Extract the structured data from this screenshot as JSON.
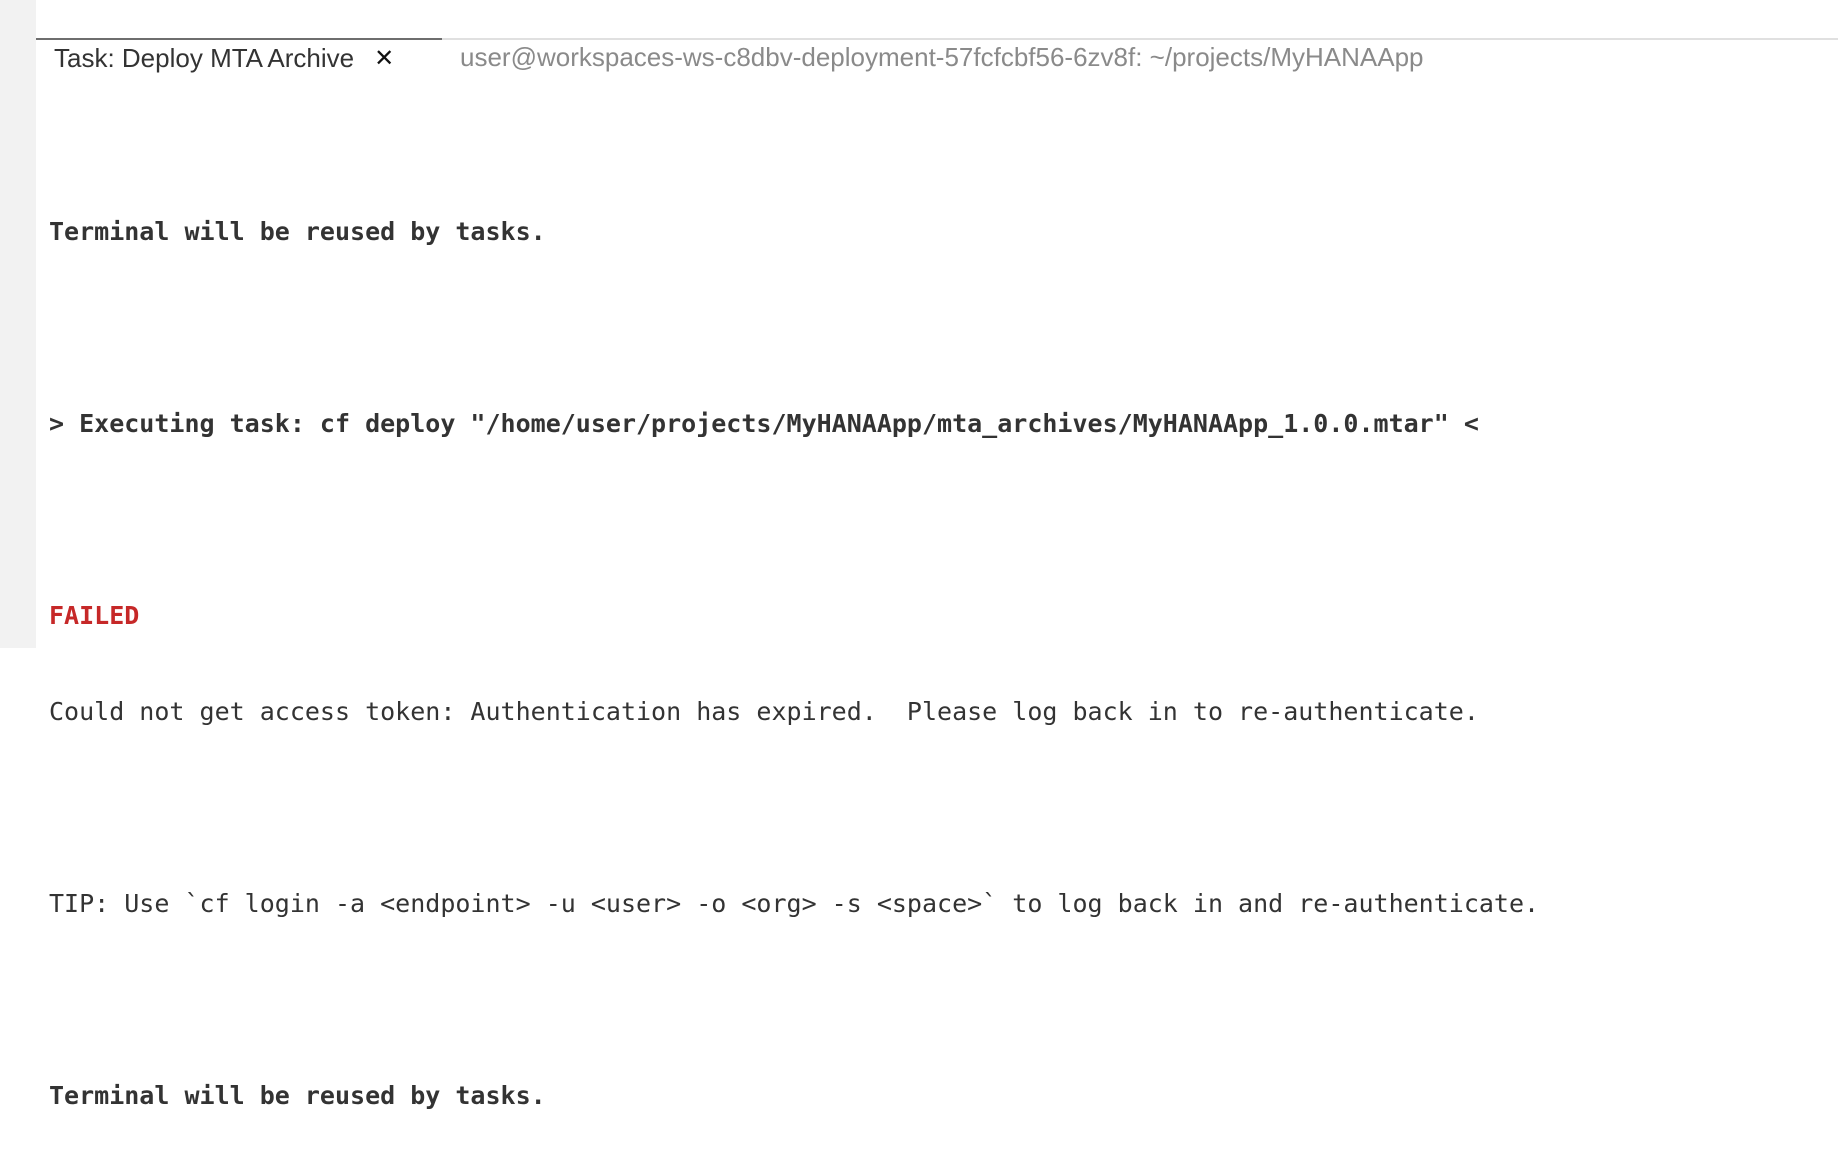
{
  "tabs": [
    {
      "label": "Task: Deploy MTA Archive",
      "active": true
    },
    {
      "label": "user@workspaces-ws-c8dbv-deployment-57fcfcbf56-6zv8f: ~/projects/MyHANAApp",
      "active": false
    }
  ],
  "terminal": {
    "line1": "Terminal will be reused by tasks.",
    "line2": "> Executing task: cf deploy \"/home/user/projects/MyHANAApp/mta_archives/MyHANAApp_1.0.0.mtar\" <",
    "failed": "FAILED",
    "error": "Could not get access token: Authentication has expired.  Please log back in to re-authenticate.",
    "tip": "TIP: Use `cf login -a <endpoint> -u <user> -o <org> -s <space>` to log back in and re-authenticate.",
    "line_last": "Terminal will be reused by tasks."
  },
  "colors": {
    "failed": "#c62828",
    "text": "#333333",
    "tab_inactive": "#8a8a8a"
  },
  "icons": {
    "close": "close-icon"
  }
}
